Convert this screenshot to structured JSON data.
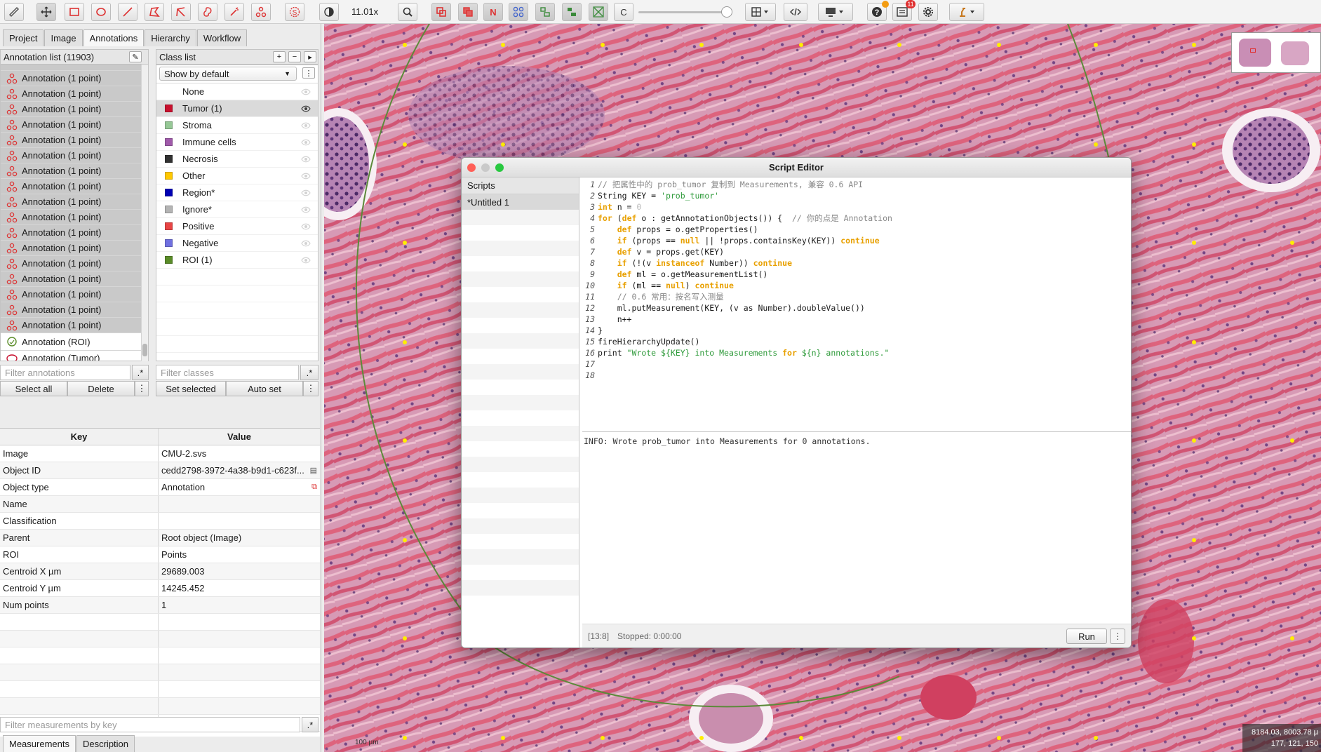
{
  "toolbar": {
    "zoom": "11.01x",
    "selection_mode_label": "N",
    "count_label": "C",
    "notification_badge": "11"
  },
  "left_tabs": [
    "Project",
    "Image",
    "Annotations",
    "Hierarchy",
    "Workflow"
  ],
  "annotation_list": {
    "header": "Annotation list (11903)",
    "point_label": "Annotation (1 point)",
    "roi_label": "Annotation (ROI)",
    "tumor_label": "Annotation (Tumor)",
    "filter_placeholder": "Filter annotations",
    "select_all": "Select all",
    "delete": "Delete"
  },
  "class_list": {
    "header": "Class list",
    "dropdown": "Show by default",
    "classes": [
      {
        "name": "None",
        "color": ""
      },
      {
        "name": "Tumor (1)",
        "color": "#c8102e"
      },
      {
        "name": "Stroma",
        "color": "#96c896"
      },
      {
        "name": "Immune cells",
        "color": "#a05aaa"
      },
      {
        "name": "Necrosis",
        "color": "#323232"
      },
      {
        "name": "Other",
        "color": "#ffc800"
      },
      {
        "name": "Region*",
        "color": "#0000b4"
      },
      {
        "name": "Ignore*",
        "color": "#b4b4b4"
      },
      {
        "name": "Positive",
        "color": "#e84545"
      },
      {
        "name": "Negative",
        "color": "#7070e0"
      },
      {
        "name": "ROI (1)",
        "color": "#5a8c28"
      }
    ],
    "filter_placeholder": "Filter classes",
    "set_selected": "Set selected",
    "auto_set": "Auto set"
  },
  "properties": {
    "key_header": "Key",
    "value_header": "Value",
    "rows": [
      {
        "key": "Image",
        "value": "CMU-2.svs"
      },
      {
        "key": "Object ID",
        "value": "cedd2798-3972-4a38-b9d1-c623f..."
      },
      {
        "key": "Object type",
        "value": "Annotation"
      },
      {
        "key": "Name",
        "value": ""
      },
      {
        "key": "Classification",
        "value": ""
      },
      {
        "key": "Parent",
        "value": "Root object (Image)"
      },
      {
        "key": "ROI",
        "value": "Points"
      },
      {
        "key": "Centroid X µm",
        "value": "29689.003"
      },
      {
        "key": "Centroid Y µm",
        "value": "14245.452"
      },
      {
        "key": "Num points",
        "value": "1"
      }
    ],
    "filter_placeholder": "Filter measurements by key",
    "bottom_tabs": [
      "Measurements",
      "Description"
    ]
  },
  "script_editor": {
    "title": "Script Editor",
    "scripts_header": "Scripts",
    "script_item": "*Untitled 1",
    "code": [
      "// 把属性中的 prob_tumor 复制到 Measurements, 兼容 0.6 API",
      "String KEY = 'prob_tumor'",
      "int n = 0",
      "for (def o : getAnnotationObjects()) {  // 你的点是 Annotation",
      "    def props = o.getProperties()",
      "    if (props == null || !props.containsKey(KEY)) continue",
      "    def v = props.get(KEY)",
      "    if (!(v instanceof Number)) continue",
      "    def ml = o.getMeasurementList()",
      "    if (ml == null) continue",
      "    // 0.6 常用：按名写入测量",
      "    ml.putMeasurement(KEY, (v as Number).doubleValue())",
      "    n++",
      "}",
      "fireHierarchyUpdate()",
      "print \"Wrote ${KEY} into Measurements for ${n} annotations.\"",
      "",
      ""
    ],
    "console": "INFO: Wrote prob_tumor into Measurements for 0 annotations.",
    "cursor": "[13:8]",
    "status": "Stopped: 0:00:00",
    "run": "Run"
  },
  "viewer": {
    "coords_line1": "8184.03, 8003.78 µ",
    "coords_line2": "177, 121, 150",
    "scalebar": "100 µm"
  }
}
